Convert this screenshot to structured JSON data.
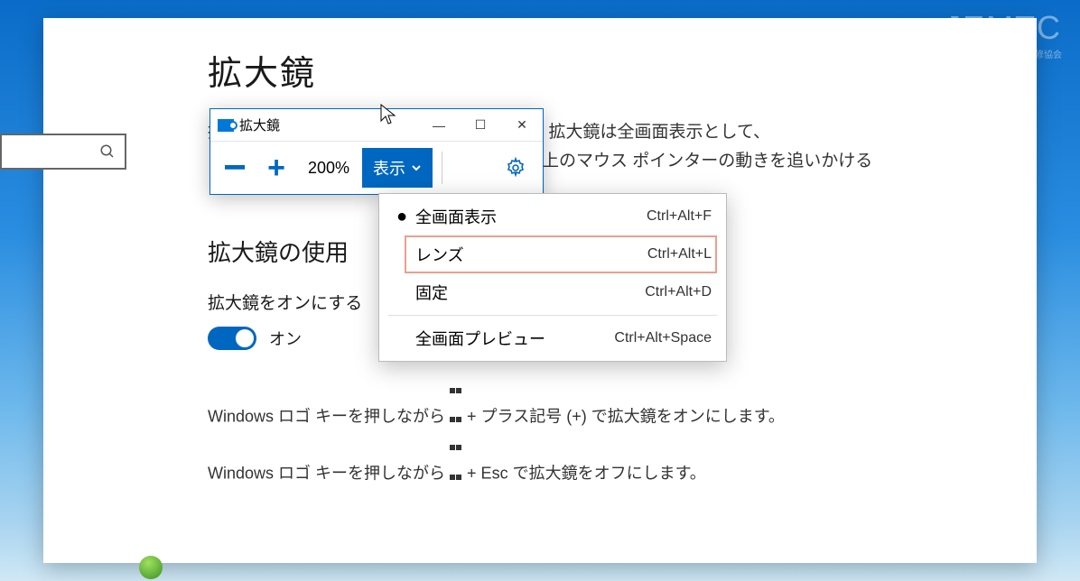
{
  "watermark": {
    "big": "JEMTC",
    "small": "一般社団法人　日本電子機器補修協会"
  },
  "page": {
    "title": "拡大鏡",
    "desc1": "拡大鏡を使用して画面の一部を拡大します。拡大鏡は全画面表示として、",
    "desc1b": "上のマウス ポインターの動きを追いかける",
    "section": "拡大鏡の使用",
    "toggleLabel": "拡大鏡をオンにする",
    "toggleState": "オン",
    "help1a": "Windows ロゴ キーを押しながら ",
    "help1b": " + プラス記号 (+) で拡大鏡をオンにします。",
    "help2a": "Windows ロゴ キーを押しながら ",
    "help2b": " + Esc で拡大鏡をオフにします。"
  },
  "magnifier": {
    "title": "拡大鏡",
    "zoom": "200%",
    "viewLabel": "表示",
    "menu": [
      {
        "label": "全画面表示",
        "shortcut": "Ctrl+Alt+F",
        "selected": true
      },
      {
        "label": "レンズ",
        "shortcut": "Ctrl+Alt+L",
        "selected": false,
        "highlighted": true
      },
      {
        "label": "固定",
        "shortcut": "Ctrl+Alt+D",
        "selected": false
      },
      {
        "label": "全画面プレビュー",
        "shortcut": "Ctrl+Alt+Space",
        "selected": false,
        "separatorBefore": true
      }
    ]
  }
}
